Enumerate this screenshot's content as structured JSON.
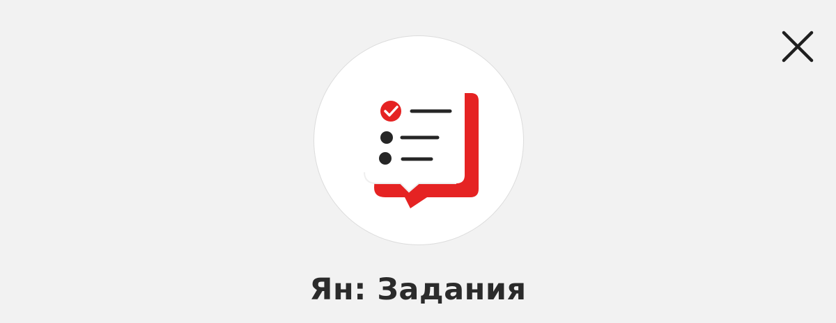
{
  "app": {
    "title": "Ян: Задания",
    "icon": "tasks-checklist-icon",
    "accent_color": "#e52323"
  },
  "dialog": {
    "close_icon": "close-icon"
  }
}
